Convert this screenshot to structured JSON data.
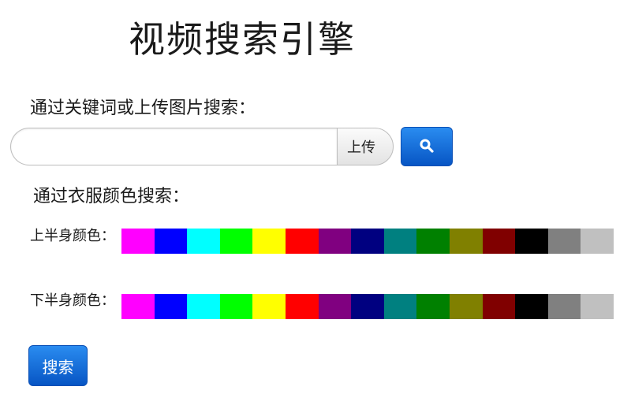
{
  "title": "视频搜索引擎",
  "keyword_section": {
    "label": "通过关键词或上传图片搜索：",
    "search_value": "",
    "search_placeholder": "",
    "upload_label": "上传",
    "search_icon": "search-icon"
  },
  "color_section": {
    "label": "通过衣服颜色搜索：",
    "upper_label": "上半身颜色：",
    "lower_label": "下半身颜色："
  },
  "palette": [
    "#ff00ff",
    "#0000ff",
    "#00ffff",
    "#00ff00",
    "#ffff00",
    "#ff0000",
    "#800080",
    "#000080",
    "#008080",
    "#008000",
    "#808000",
    "#800000",
    "#000000",
    "#808080",
    "#c0c0c0"
  ],
  "submit_label": "搜索"
}
